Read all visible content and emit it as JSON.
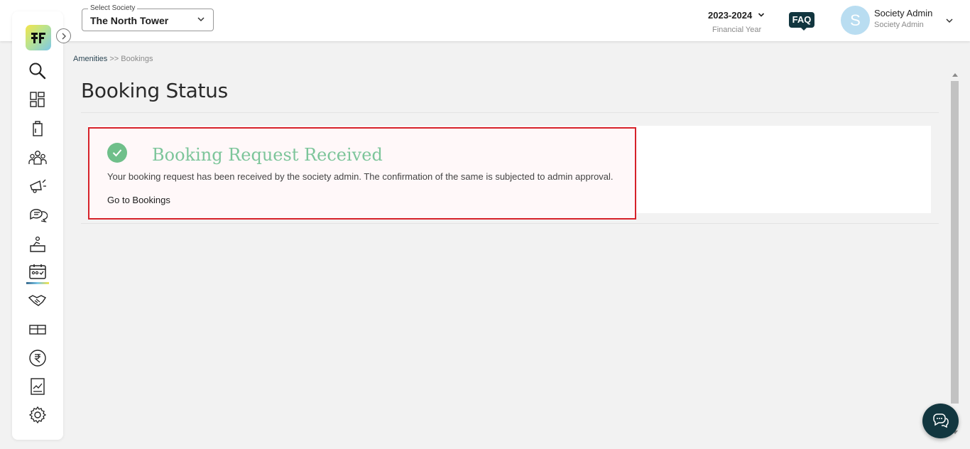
{
  "header": {
    "society_select": {
      "label": "Select Society",
      "value": "The North Tower"
    },
    "financial_year": {
      "value": "2023-2024",
      "label": "Financial Year"
    },
    "faq_label": "FAQ",
    "user": {
      "initial": "S",
      "name": "Society Admin",
      "role": "Society Admin"
    }
  },
  "sidebar": {
    "items": [
      {
        "icon": "search-icon"
      },
      {
        "icon": "dashboard-icon"
      },
      {
        "icon": "building-icon"
      },
      {
        "icon": "members-icon"
      },
      {
        "icon": "announcement-icon"
      },
      {
        "icon": "chat-icon"
      },
      {
        "icon": "helpdesk-icon"
      },
      {
        "icon": "amenities-calendar-icon",
        "active": true
      },
      {
        "icon": "handshake-icon"
      },
      {
        "icon": "parcel-icon"
      },
      {
        "icon": "rupee-icon"
      },
      {
        "icon": "reports-icon"
      },
      {
        "icon": "settings-icon"
      }
    ]
  },
  "breadcrumb": {
    "parent": "Amenities",
    "separator": ">>",
    "current": "Bookings"
  },
  "page_title": "Booking Status",
  "status": {
    "heading": "Booking Request Received",
    "message": "Your booking request has been received by the society admin. The confirmation of the same is subjected to admin approval.",
    "link_label": "Go to Bookings"
  },
  "colors": {
    "accent_dark": "#12363f",
    "success_green": "#6fbf8a",
    "highlight_red": "#d6222a"
  }
}
